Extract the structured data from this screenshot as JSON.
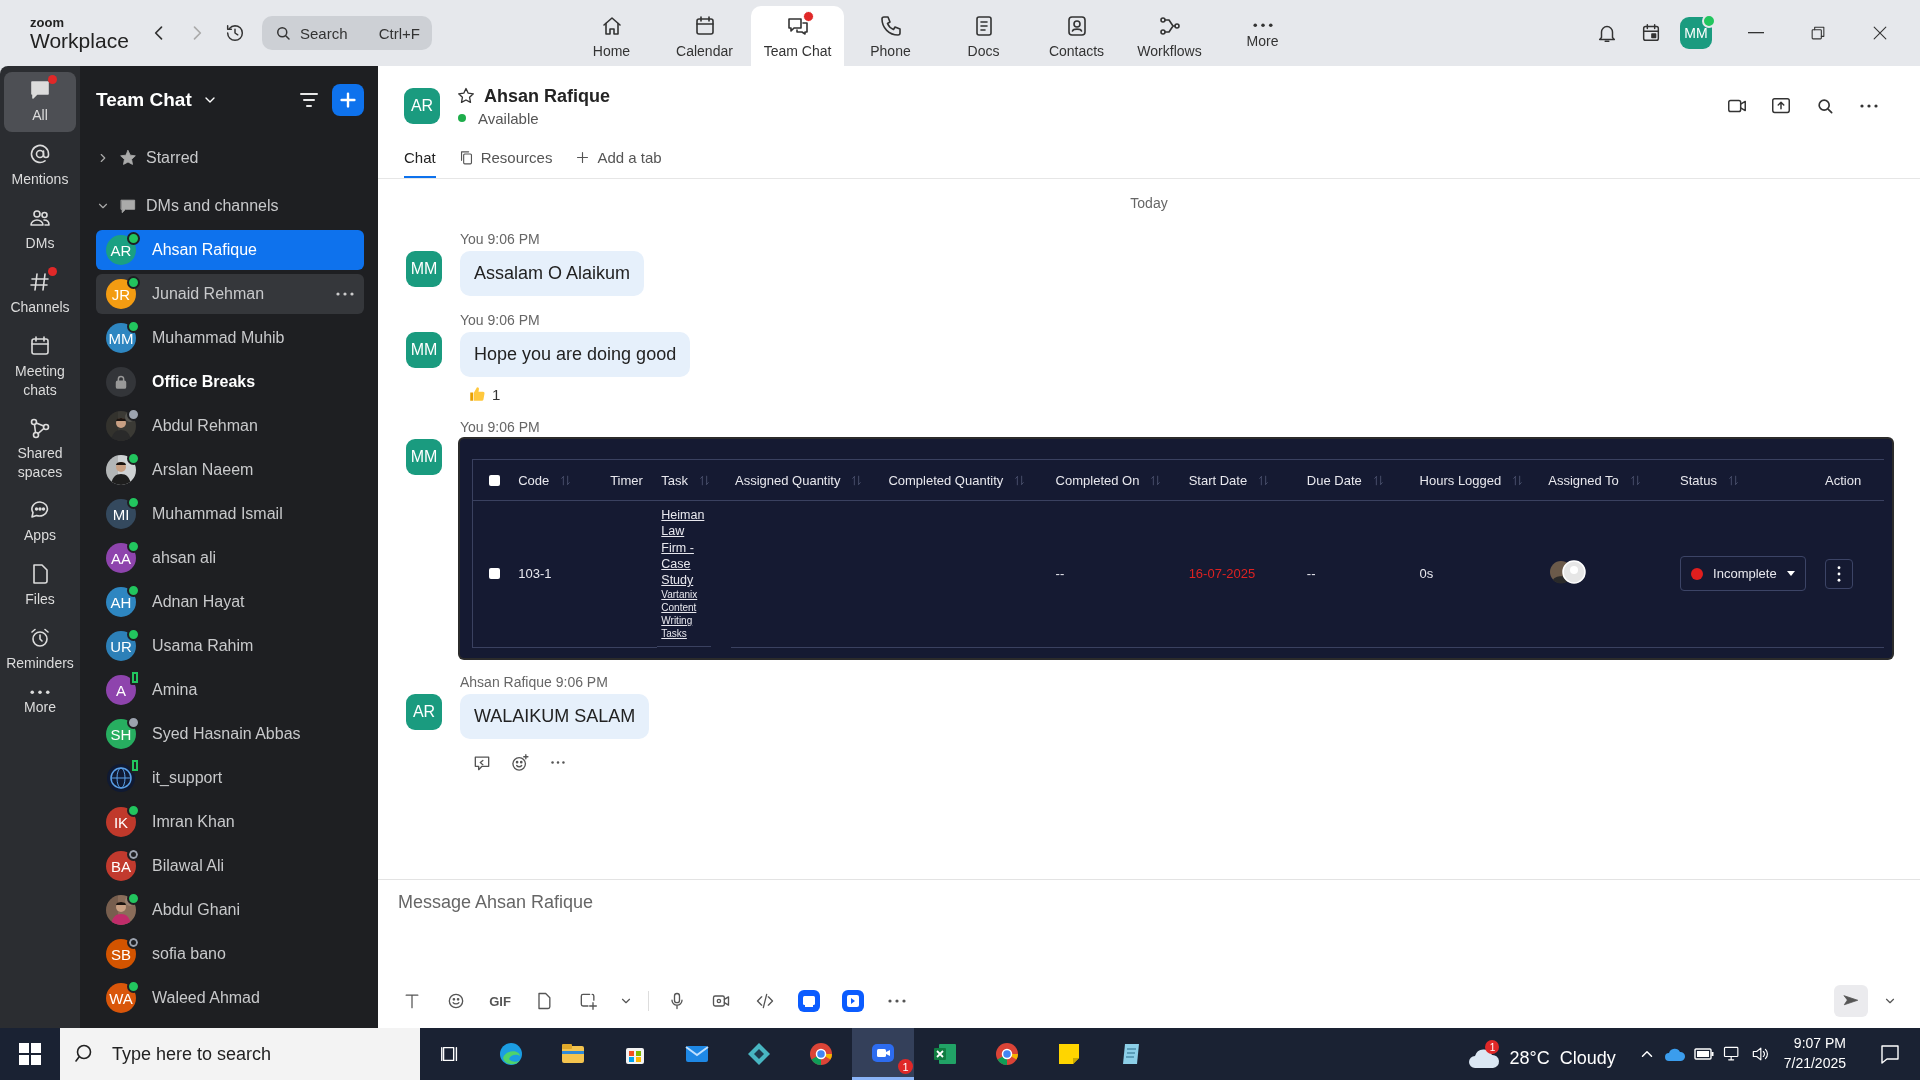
{
  "app": {
    "logo_small": "zoom",
    "logo_large": "Workplace",
    "search": {
      "placeholder": "Search",
      "shortcut": "Ctrl+F"
    },
    "nav": [
      {
        "label": "Home",
        "selected": false,
        "badge": false
      },
      {
        "label": "Calendar",
        "selected": false,
        "badge": false
      },
      {
        "label": "Team Chat",
        "selected": true,
        "badge": true
      },
      {
        "label": "Phone",
        "selected": false,
        "badge": false
      },
      {
        "label": "Docs",
        "selected": false,
        "badge": false
      },
      {
        "label": "Contacts",
        "selected": false,
        "badge": false
      },
      {
        "label": "Workflows",
        "selected": false,
        "badge": false
      },
      {
        "label": "More",
        "selected": false,
        "badge": false
      }
    ],
    "user": {
      "initials": "MM",
      "status": {
        "kind": "online"
      }
    }
  },
  "rail": [
    {
      "label": "All",
      "selected": true,
      "badge": true
    },
    {
      "label": "Mentions",
      "selected": false,
      "badge": false
    },
    {
      "label": "DMs",
      "selected": false,
      "badge": false
    },
    {
      "label": "Channels",
      "selected": false,
      "badge": true
    },
    {
      "label": "Meeting chats",
      "selected": false,
      "badge": false
    },
    {
      "label": "Shared spaces",
      "selected": false,
      "badge": false
    },
    {
      "label": "Apps",
      "selected": false,
      "badge": false
    },
    {
      "label": "Files",
      "selected": false,
      "badge": false
    },
    {
      "label": "Reminders",
      "selected": false,
      "badge": false
    },
    {
      "label": "More",
      "selected": false,
      "badge": false
    }
  ],
  "sidebar": {
    "title": "Team Chat",
    "sections": [
      {
        "label": "Starred",
        "expanded": false
      },
      {
        "label": "DMs and channels",
        "expanded": true
      }
    ],
    "contacts": [
      {
        "kind": "initials",
        "initials": "AR",
        "color": "#1aa082",
        "name": "Ahsan Rafique",
        "status": {
          "kind": "online"
        },
        "selected": true,
        "hovered": false,
        "unread": false
      },
      {
        "kind": "initials",
        "initials": "JR",
        "color": "#f39c12",
        "name": "Junaid Rehman",
        "status": {
          "kind": "online"
        },
        "selected": false,
        "hovered": true,
        "unread": false
      },
      {
        "kind": "initials",
        "initials": "MM",
        "color": "#2e86c1",
        "name": "Muhammad Muhib",
        "status": {
          "kind": "online"
        },
        "selected": false,
        "hovered": false,
        "unread": false
      },
      {
        "kind": "lock",
        "name": "Office Breaks",
        "selected": false,
        "hovered": false,
        "unread": true
      },
      {
        "name": "Abdul Rehman",
        "status": {
          "kind": "away"
        },
        "selected": false,
        "hovered": false,
        "unread": false
      },
      {
        "name": "Arslan Naeem",
        "status": {
          "kind": "online"
        },
        "selected": false,
        "hovered": false,
        "unread": false
      },
      {
        "kind": "initials",
        "initials": "MI",
        "color": "#34495e",
        "name": "Muhammad Ismail",
        "status": {
          "kind": "online"
        },
        "selected": false,
        "hovered": false,
        "unread": false
      },
      {
        "kind": "initials",
        "initials": "AA",
        "color": "#8e44ad",
        "name": "ahsan ali",
        "status": {
          "kind": "online"
        },
        "selected": false,
        "hovered": false,
        "unread": false
      },
      {
        "kind": "initials",
        "initials": "AH",
        "color": "#2e86c1",
        "name": "Adnan Hayat",
        "status": {
          "kind": "online"
        },
        "selected": false,
        "hovered": false,
        "unread": false
      },
      {
        "kind": "initials",
        "initials": "UR",
        "color": "#2d80b8",
        "name": "Usama Rahim",
        "status": {
          "kind": "online"
        },
        "selected": false,
        "hovered": false,
        "unread": false
      },
      {
        "kind": "initials",
        "initials": "A",
        "color": "#8e44ad",
        "name": "Amina",
        "status": {
          "kind": "mobile"
        },
        "selected": false,
        "hovered": false,
        "unread": false
      },
      {
        "kind": "initials",
        "initials": "SH",
        "color": "#27ae60",
        "name": "Syed Hasnain Abbas",
        "status": {
          "kind": "away"
        },
        "selected": false,
        "hovered": false,
        "unread": false
      },
      {
        "kind": "logo",
        "name": "it_support",
        "status": {
          "kind": "mobile"
        },
        "selected": false,
        "hovered": false,
        "unread": false
      },
      {
        "kind": "initials",
        "initials": "IK",
        "color": "#c0392b",
        "name": "Imran Khan",
        "status": {
          "kind": "online"
        },
        "selected": false,
        "hovered": false,
        "unread": false
      },
      {
        "kind": "initials",
        "initials": "BA",
        "color": "#c23a2e",
        "name": "Bilawal Ali",
        "status": {
          "kind": "offline"
        },
        "selected": false,
        "hovered": false,
        "unread": false
      },
      {
        "name": "Abdul Ghani",
        "status": {
          "kind": "online"
        },
        "selected": false,
        "hovered": false,
        "unread": false
      },
      {
        "kind": "initials",
        "initials": "SB",
        "color": "#d35400",
        "name": "sofia bano",
        "status": {
          "kind": "offline"
        },
        "selected": false,
        "hovered": false,
        "unread": false
      },
      {
        "kind": "initials",
        "initials": "WA",
        "color": "#d9560a",
        "name": "Waleed Ahmad",
        "status": {
          "kind": "online"
        },
        "selected": false,
        "hovered": false,
        "unread": false
      }
    ]
  },
  "chat": {
    "initials": "AR",
    "name": "Ahsan Rafique",
    "presence": "Available",
    "tabs": [
      {
        "label": "Chat",
        "selected": true
      },
      {
        "label": "Resources",
        "selected": false
      }
    ],
    "add_tab": "Add a tab",
    "day": "Today",
    "messages": [
      {
        "kind": "text",
        "sender": "You",
        "time": "9:06 PM",
        "initials": "MM",
        "text": "Assalam O Alaikum"
      },
      {
        "kind": "text",
        "sender": "You",
        "time": "9:06 PM",
        "initials": "MM",
        "text": "Hope you are doing good",
        "reaction_count": "1"
      },
      {
        "kind": "table",
        "sender": "You",
        "time": "9:06 PM",
        "initials": "MM",
        "table": {
          "all_checked": false,
          "columns": [
            {
              "label": "Code",
              "sortable": true
            },
            {
              "label": "Timer",
              "sortable": false
            },
            {
              "label": "Task",
              "sortable": true
            },
            {
              "label": "Assigned Quantity",
              "sortable": true
            },
            {
              "label": "Completed Quantity",
              "sortable": true
            },
            {
              "label": "Completed On",
              "sortable": true
            },
            {
              "label": "Start Date",
              "sortable": true
            },
            {
              "label": "Due Date",
              "sortable": true
            },
            {
              "label": "Hours Logged",
              "sortable": true
            },
            {
              "label": "Assigned To",
              "sortable": true
            },
            {
              "label": "Status",
              "sortable": true
            },
            {
              "label": "Action",
              "sortable": false
            }
          ],
          "rows": [
            {
              "checked": false,
              "code": "103-1",
              "task": "Heiman Law Firm - Case Study",
              "project": "Vartanix Content Writing Tasks",
              "completed_on": "--",
              "start_date": "16-07-2025",
              "due_date": "--",
              "hours_logged": "0s",
              "status": "Incomplete"
            }
          ]
        }
      },
      {
        "kind": "text",
        "sender": "Ahsan Rafique",
        "time": "9:06 PM",
        "initials": "AR",
        "text": "WALAIKUM SALAM",
        "actions": true
      }
    ]
  },
  "composer": {
    "placeholder": "Message Ahsan Rafique",
    "gif": "GIF"
  },
  "taskbar": {
    "search_placeholder": "Type here to search",
    "weather_badge": "1",
    "weather": "28°C  Cloudy",
    "app_badge": "1",
    "time": "9:07 PM",
    "date": "7/21/2025"
  }
}
